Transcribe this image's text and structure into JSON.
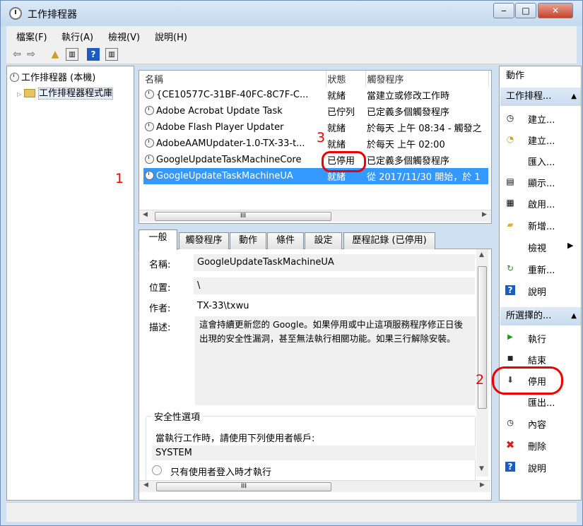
{
  "window": {
    "title": "工作排程器",
    "min": "‒",
    "max": "□",
    "close": "✕"
  },
  "menu": [
    "檔案(F)",
    "執行(A)",
    "檢視(V)",
    "說明(H)"
  ],
  "tree": {
    "root": "工作排程器 (本機)",
    "library": "工作排程器程式庫"
  },
  "tasks": {
    "headers": [
      "名稱",
      "狀態",
      "觸發程序"
    ],
    "rows": [
      {
        "name": "{CE10577C-31BF-40FC-8C7F-C...",
        "status": "就緒",
        "trigger": "當建立或修改工作時"
      },
      {
        "name": "Adobe Acrobat Update Task",
        "status": "已佇列",
        "trigger": "已定義多個觸發程序"
      },
      {
        "name": "Adobe Flash Player Updater",
        "status": "就緒",
        "trigger": "於每天 上午 08:34 - 觸發之"
      },
      {
        "name": "AdobeAAMUpdater-1.0-TX-33-t...",
        "status": "就緒",
        "trigger": "於每天 上午 02:00"
      },
      {
        "name": "GoogleUpdateTaskMachineCore",
        "status": "已停用",
        "trigger": "已定義多個觸發程序"
      },
      {
        "name": "GoogleUpdateTaskMachineUA",
        "status": "就緒",
        "trigger": "從 2017/11/30 開始，於 1"
      }
    ],
    "hscroll_grip": "III"
  },
  "tabs": [
    "一般",
    "觸發程序",
    "動作",
    "條件",
    "設定",
    "歷程記錄 (已停用)"
  ],
  "general": {
    "name_label": "名稱:",
    "name_value": "GoogleUpdateTaskMachineUA",
    "location_label": "位置:",
    "location_value": "\\",
    "author_label": "作者:",
    "author_value": "TX-33\\txwu",
    "desc_label": "描述:",
    "desc_value": "這會持續更新您的 Google。如果停用或中止這項服務程序修正日後出現的安全性漏洞，甚至無法執行相關功能。如果三行解除安裝。",
    "security_title": "安全性選項",
    "security_prompt": "當執行工作時，請使用下列使用者帳戶:",
    "security_account": "SYSTEM",
    "radio_only_logged": "只有使用者登入時才執行",
    "hscroll_grip": "III"
  },
  "actions": {
    "header": "動作",
    "section1": "工作排程...",
    "items1": [
      {
        "icon": "create-basic-task-icon",
        "glyph": "◷",
        "label": "建立..."
      },
      {
        "icon": "create-task-icon",
        "glyph": "◔",
        "label": "建立..."
      },
      {
        "icon": "import-icon",
        "glyph": "",
        "label": "匯入..."
      },
      {
        "icon": "display-icon",
        "glyph": "▤",
        "label": "顯示..."
      },
      {
        "icon": "enable-icon",
        "glyph": "▦",
        "label": "啟用..."
      },
      {
        "icon": "new-folder-icon",
        "glyph": "▰",
        "label": "新增..."
      },
      {
        "icon": "view-icon",
        "glyph": "",
        "label": "檢視"
      },
      {
        "icon": "refresh-icon",
        "glyph": "↻",
        "label": "重新..."
      },
      {
        "icon": "help-icon",
        "glyph": "?",
        "label": "說明"
      }
    ],
    "view_arrow": "▶",
    "section2": "所選擇的...",
    "items2": [
      {
        "icon": "run-icon",
        "glyph": "▶",
        "label": "執行"
      },
      {
        "icon": "end-icon",
        "glyph": "■",
        "label": "結束"
      },
      {
        "icon": "disable-icon",
        "glyph": "⬇",
        "label": "停用"
      },
      {
        "icon": "export-icon",
        "glyph": "",
        "label": "匯出..."
      },
      {
        "icon": "properties-icon",
        "glyph": "◷",
        "label": "內容"
      },
      {
        "icon": "delete-icon",
        "glyph": "✖",
        "label": "刪除"
      },
      {
        "icon": "help-icon",
        "glyph": "?",
        "label": "說明"
      }
    ],
    "collapse_glyph": "▲"
  },
  "annotations": [
    "1",
    "2",
    "3"
  ],
  "colors": {
    "selection": "#3399ff",
    "annotation": "#ee0000",
    "action_header": "#c9dbee"
  }
}
